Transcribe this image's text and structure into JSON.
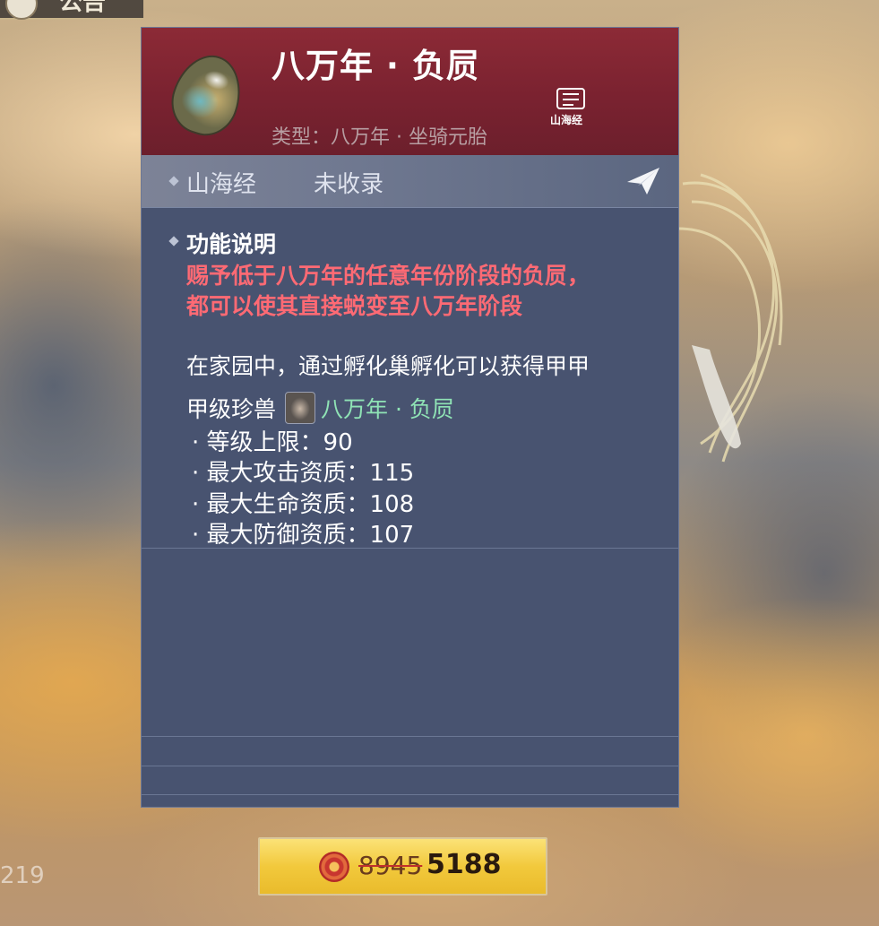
{
  "topbar": {
    "label": "公告"
  },
  "side_counter": "219",
  "item": {
    "name": "八万年 · 负屃",
    "type": "类型：八万年 · 坐骑元胎",
    "collection_icon_label": "山海经"
  },
  "tabs": {
    "tab1": "山海经",
    "tab2": "未收录"
  },
  "function": {
    "title": "功能说明",
    "red_line1": "赐予低于八万年的任意年份阶段的负屃，",
    "red_line2": "都可以使其直接蜕变至八万年阶段",
    "desc": "在家园中，通过孵化巢孵化可以获得甲甲",
    "grade_label": "甲级珍兽",
    "pet_name": "八万年 · 负屃",
    "stats": [
      "· 等级上限：90",
      "· 最大攻击资质：115",
      "· 最大生命资质：108",
      "· 最大防御资质：107"
    ]
  },
  "price": {
    "old": "8945",
    "new": "5188"
  },
  "colors": {
    "header_red": "#7a2230",
    "panel_blue": "#485370",
    "highlight_red": "#ff6a74",
    "pet_green": "#8fe3b5",
    "buy_gold": "#f2c93c"
  }
}
